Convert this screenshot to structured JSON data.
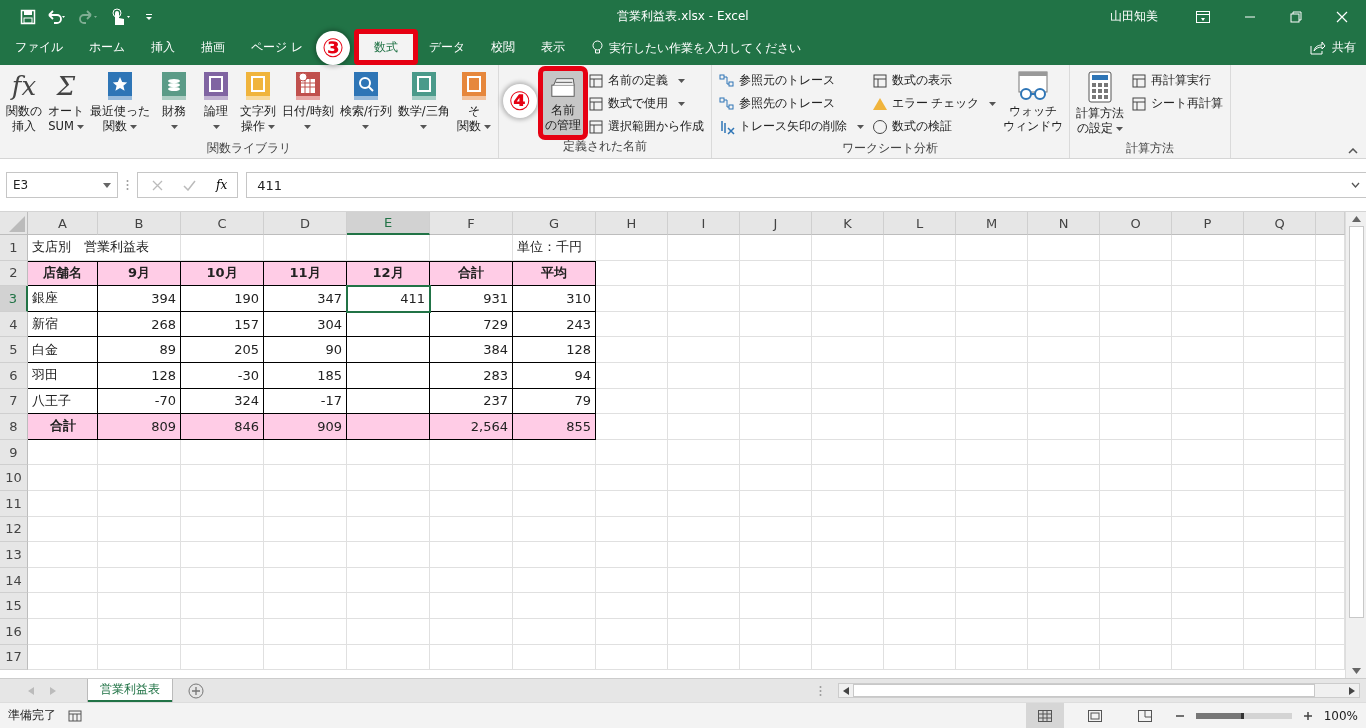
{
  "title_bar": {
    "title": "営業利益表.xlsx  -  Excel",
    "user": "山田知美"
  },
  "tabs": [
    {
      "label": "ファイル",
      "selected": false
    },
    {
      "label": "ホーム",
      "selected": false
    },
    {
      "label": "挿入",
      "selected": false
    },
    {
      "label": "描画",
      "selected": false
    },
    {
      "label": "ページ レ",
      "selected": false
    },
    {
      "label": "数式",
      "selected": true,
      "highlighted": true,
      "callout": "③"
    },
    {
      "label": "データ",
      "selected": false
    },
    {
      "label": "校閲",
      "selected": false
    },
    {
      "label": "表示",
      "selected": false
    }
  ],
  "tell_me": {
    "placeholder": "実行したい作業を入力してください"
  },
  "share": {
    "label": "共有"
  },
  "ribbon": [
    {
      "label": "関数ライブラリ",
      "items": [
        {
          "kind": "large",
          "lines": [
            "関数の",
            "挿入"
          ],
          "glyph": "fx"
        },
        {
          "kind": "large",
          "lines": [
            "オート",
            "SUM"
          ],
          "dropdown": true,
          "glyph": "Σ"
        },
        {
          "kind": "large",
          "lines": [
            "最近使った",
            "関数"
          ],
          "dropdown": true
        },
        {
          "kind": "large",
          "lines": [
            "財務"
          ],
          "dropdown": true
        },
        {
          "kind": "large",
          "lines": [
            "論理"
          ],
          "dropdown": true
        },
        {
          "kind": "large",
          "lines": [
            "文字列",
            "操作"
          ],
          "dropdown": true
        },
        {
          "kind": "large",
          "lines": [
            "日付/時刻"
          ],
          "dropdown": true
        },
        {
          "kind": "large",
          "lines": [
            "検索/行列"
          ],
          "dropdown": true
        },
        {
          "kind": "large",
          "lines": [
            "数学/三角"
          ],
          "dropdown": true
        },
        {
          "kind": "large",
          "lines": [
            "そ",
            "関数"
          ],
          "dropdown": true
        }
      ]
    },
    {
      "label": "定義された名前",
      "items": [
        {
          "kind": "large",
          "lines": [
            "名前",
            "の管理"
          ],
          "highlighted": true,
          "pressed": true,
          "callout": "④"
        },
        {
          "kind": "stack",
          "items": [
            {
              "label": "名前の定義",
              "dropdown": true
            },
            {
              "label": "数式で使用",
              "dropdown": true
            },
            {
              "label": "選択範囲から作成"
            }
          ]
        }
      ]
    },
    {
      "label": "ワークシート分析",
      "items": [
        {
          "kind": "stack",
          "items": [
            {
              "label": "参照元のトレース"
            },
            {
              "label": "参照先のトレース"
            },
            {
              "label": "トレース矢印の削除",
              "dropdown": true
            }
          ]
        },
        {
          "kind": "stack",
          "items": [
            {
              "label": "数式の表示"
            },
            {
              "label": "エラー チェック",
              "dropdown": true
            },
            {
              "label": "数式の検証"
            }
          ]
        },
        {
          "kind": "large",
          "lines": [
            "ウォッチ",
            "ウィンドウ"
          ]
        }
      ]
    },
    {
      "label": "計算方法",
      "items": [
        {
          "kind": "large",
          "lines": [
            "計算方法",
            "の設定"
          ],
          "dropdown": true
        },
        {
          "kind": "stack",
          "items": [
            {
              "label": "再計算実行"
            },
            {
              "label": "シート再計算"
            }
          ]
        }
      ]
    }
  ],
  "formula_bar": {
    "name_box": "E3",
    "fx": "fx",
    "value": "411"
  },
  "sheet": {
    "columns": [
      {
        "label": "A",
        "selected": false
      },
      {
        "label": "B",
        "selected": false
      },
      {
        "label": "C",
        "selected": false
      },
      {
        "label": "D",
        "selected": false
      },
      {
        "label": "E",
        "selected": true
      },
      {
        "label": "F",
        "selected": false
      },
      {
        "label": "G",
        "selected": false
      },
      {
        "label": "H",
        "selected": false
      },
      {
        "label": "I",
        "selected": false
      },
      {
        "label": "J",
        "selected": false
      },
      {
        "label": "K",
        "selected": false
      },
      {
        "label": "L",
        "selected": false
      },
      {
        "label": "M",
        "selected": false
      },
      {
        "label": "N",
        "selected": false
      },
      {
        "label": "O",
        "selected": false
      },
      {
        "label": "P",
        "selected": false
      },
      {
        "label": "Q",
        "selected": false
      }
    ],
    "rows": [
      {
        "number": "1",
        "kind": "title",
        "selected": false,
        "cells": [
          "支店別　営業利益表",
          null,
          null,
          null,
          null,
          null,
          "単位：千円"
        ]
      },
      {
        "number": "2",
        "kind": "header",
        "selected": false,
        "cells": [
          "店舗名",
          "9月",
          "10月",
          "11月",
          "12月",
          "合計",
          "平均"
        ]
      },
      {
        "number": "3",
        "kind": "data",
        "selected": true,
        "cells": [
          "銀座",
          "394",
          "190",
          "347",
          "411",
          "931",
          "310"
        ]
      },
      {
        "number": "4",
        "kind": "data",
        "selected": false,
        "cells": [
          "新宿",
          "268",
          "157",
          "304",
          null,
          "729",
          "243"
        ]
      },
      {
        "number": "5",
        "kind": "data",
        "selected": false,
        "cells": [
          "白金",
          "89",
          "205",
          "90",
          null,
          "384",
          "128"
        ]
      },
      {
        "number": "6",
        "kind": "data",
        "selected": false,
        "cells": [
          "羽田",
          "128",
          "-30",
          "185",
          null,
          "283",
          "94"
        ]
      },
      {
        "number": "7",
        "kind": "data",
        "selected": false,
        "cells": [
          "八王子",
          "-70",
          "324",
          "-17",
          null,
          "237",
          "79"
        ]
      },
      {
        "number": "8",
        "kind": "total",
        "selected": false,
        "cells": [
          "合計",
          "809",
          "846",
          "909",
          null,
          "2,564",
          "855"
        ]
      },
      {
        "number": "9",
        "kind": "empty",
        "selected": false,
        "cells": []
      },
      {
        "number": "10",
        "kind": "empty",
        "selected": false,
        "cells": []
      },
      {
        "number": "11",
        "kind": "empty",
        "selected": false,
        "cells": []
      },
      {
        "number": "12",
        "kind": "empty",
        "selected": false,
        "cells": []
      },
      {
        "number": "13",
        "kind": "empty",
        "selected": false,
        "cells": []
      },
      {
        "number": "14",
        "kind": "empty",
        "selected": false,
        "cells": []
      },
      {
        "number": "15",
        "kind": "empty",
        "selected": false,
        "cells": []
      },
      {
        "number": "16",
        "kind": "empty",
        "selected": false,
        "cells": []
      },
      {
        "number": "17",
        "kind": "empty",
        "selected": false,
        "cells": []
      }
    ]
  },
  "sheet_tabs": [
    {
      "label": "営業利益表",
      "selected": true
    }
  ],
  "status_bar": {
    "status": "準備完了",
    "zoom": "100%",
    "zoom_level": {
      "level": 0.5
    }
  }
}
